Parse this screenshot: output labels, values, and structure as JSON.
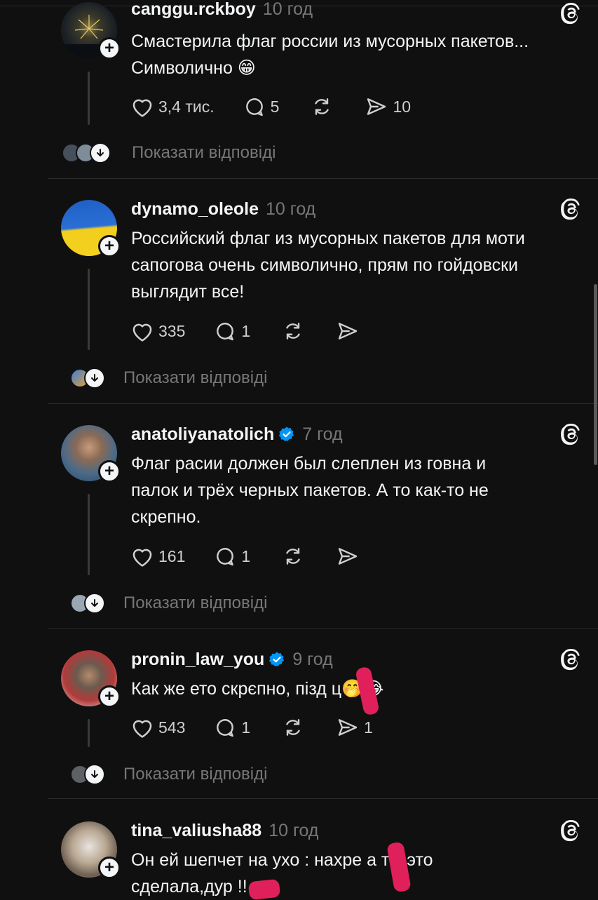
{
  "posts": [
    {
      "username": "canggu.rckboy",
      "time": "10 год",
      "text_lines": [
        "Смастерила флаг россии из мусорных пакетов...",
        "Символично 😁"
      ],
      "likes": "3,4 тис.",
      "comments": "5",
      "reposts": "",
      "shares": "10",
      "show_replies": "Показати відповіді",
      "verified": false
    },
    {
      "username": "dynamo_oleole",
      "time": "10 год",
      "text_lines": [
        "Российский флаг из мусорных пакетов для моти",
        "сапогова очень символично, прям по гойдовски",
        "выглядит все!"
      ],
      "likes": "335",
      "comments": "1",
      "reposts": "",
      "shares": "",
      "show_replies": "Показати відповіді",
      "verified": false
    },
    {
      "username": "anatoliyanatolich",
      "time": "7 год",
      "text_lines": [
        "Флаг расии должен был слеплен из говна и",
        "палок и трёх черных пакетов. А то как-то не",
        "скрепно."
      ],
      "likes": "161",
      "comments": "1",
      "reposts": "",
      "shares": "",
      "show_replies": "Показати відповіді",
      "verified": true
    },
    {
      "username": "pronin_law_you",
      "time": "9 год",
      "text_lines": [
        "Как же ето скрєпно, пізд  ц🤭😂"
      ],
      "likes": "543",
      "comments": "1",
      "reposts": "",
      "shares": "1",
      "show_replies": "Показати відповіді",
      "verified": true
    },
    {
      "username": "tina_valiusha88",
      "time": "10 год",
      "text_lines": [
        "Он ей шепчет на ухо : нахре  а ты это",
        "сделала,дур   !!"
      ],
      "likes": "",
      "comments": "",
      "reposts": "",
      "shares": "",
      "show_replies": "",
      "verified": false
    }
  ],
  "colors": {
    "background": "#101010",
    "text": "#f3f5f7",
    "muted": "#777777",
    "verified": "#0095f6",
    "redaction": "#e0205a"
  },
  "icons": [
    "heart-icon",
    "comment-icon",
    "repost-icon",
    "share-icon",
    "threads-logo-icon",
    "plus-icon",
    "chevron-down-icon",
    "verified-badge-icon"
  ]
}
